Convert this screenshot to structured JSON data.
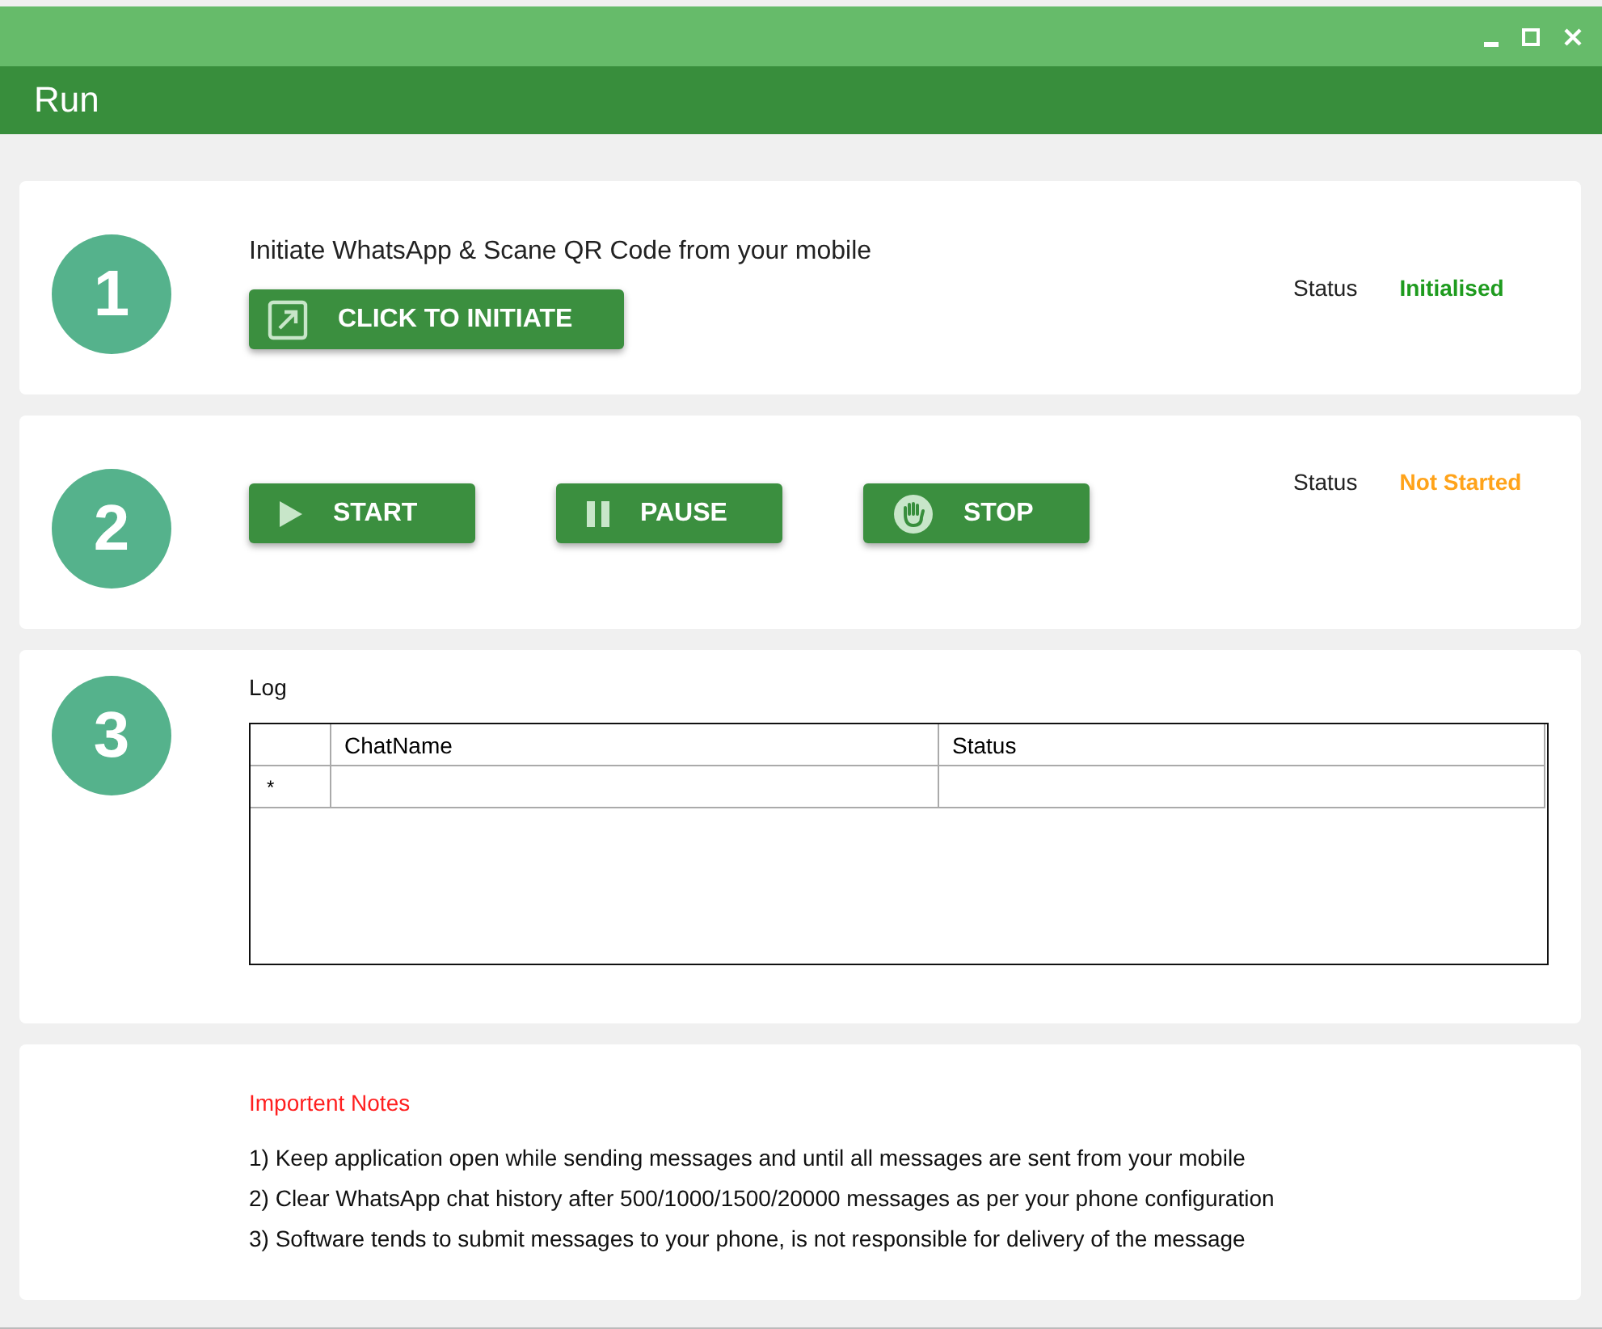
{
  "window": {
    "title": "Run",
    "controls": [
      {
        "kind": "minimize"
      },
      {
        "kind": "maximize"
      },
      {
        "kind": "close"
      }
    ]
  },
  "steps": [
    {
      "number": "1",
      "instruction": "Initiate WhatsApp & Scane QR Code from your mobile",
      "buttons": [
        {
          "kind": "initiate",
          "label": "CLICK TO INITIATE"
        }
      ],
      "status": {
        "label": "Status",
        "value": "Initialised",
        "color": "#1e9b1e"
      }
    },
    {
      "number": "2",
      "buttons": [
        {
          "kind": "play",
          "label": "START"
        },
        {
          "kind": "pause",
          "label": "PAUSE"
        },
        {
          "kind": "stop",
          "label": "STOP"
        }
      ],
      "status": {
        "label": "Status",
        "value": "Not Started",
        "color": "#ffa31a"
      }
    },
    {
      "number": "3",
      "log": {
        "label": "Log",
        "columns": [
          "ChatName",
          "Status"
        ],
        "new_row_marker": "*"
      }
    }
  ],
  "notes": {
    "title": "Importent Notes",
    "items": [
      "1) Keep application open while sending messages and until all messages are sent from your mobile",
      "2) Clear WhatsApp chat history after 500/1000/1500/20000 messages as per your phone configuration",
      "3) Software tends to submit messages to your phone, is not responsible for delivery of the message"
    ]
  }
}
